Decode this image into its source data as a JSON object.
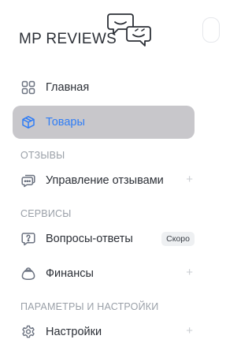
{
  "logo": {
    "text": "MP REVIEWS"
  },
  "nav": {
    "home": {
      "label": "Главная",
      "icon": "grid-icon"
    },
    "products": {
      "label": "Товары",
      "icon": "box-icon",
      "active": true
    },
    "reviews_manage": {
      "label": "Управление отзывами",
      "icon": "chat-bubbles-icon",
      "plus": "+"
    },
    "qa": {
      "label": "Вопросы-ответы",
      "icon": "question-bubble-icon",
      "badge": "Скоро"
    },
    "finance": {
      "label": "Финансы",
      "icon": "bag-icon",
      "plus": "+"
    },
    "settings": {
      "label": "Настройки",
      "icon": "gear-icon",
      "plus": "+"
    }
  },
  "sections": {
    "reviews": "ОТЗЫВЫ",
    "services": "СЕРВИСЫ",
    "params": "ПАРАМЕТРЫ И НАСТРОЙКИ"
  },
  "colors": {
    "active_bg": "#c8c7cb",
    "active_text": "#2f7df6",
    "section_text": "#9aa0a8"
  }
}
